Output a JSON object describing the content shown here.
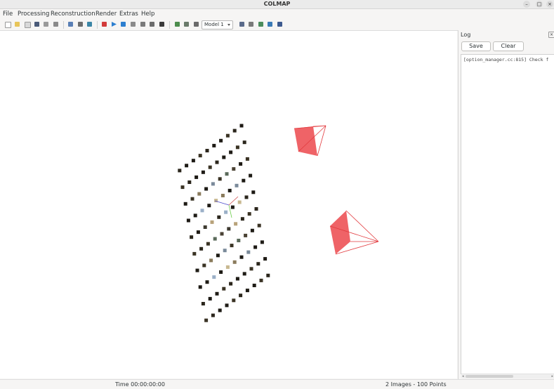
{
  "window": {
    "title": "COLMAP",
    "controls": {
      "minimize": "–",
      "maximize": "□",
      "close": "×"
    }
  },
  "menubar": {
    "items": [
      "File",
      "Processing",
      "Reconstruction",
      "Render",
      "Extras",
      "Help"
    ]
  },
  "toolbar": {
    "icons": [
      "new-project-icon",
      "open-project-icon",
      "edit-project-icon",
      "save-project-icon",
      "import-model-icon",
      "export-model-icon",
      "feature-extraction-icon",
      "feature-matching-icon",
      "database-management-icon",
      "automatic-reconstruction-icon",
      "start-reconstruction-icon",
      "step-reconstruction-icon",
      "pause-reconstruction-icon",
      "reset-reconstruction-icon",
      "bundle-adjustment-icon",
      "dense-reconstruction-icon",
      "render-options-icon",
      "grab-image-icon",
      "grab-movie-icon",
      "reconstruction-stats-icon",
      "match-matrix-icon",
      "log-icon",
      "undistort-icon",
      "export-icon"
    ],
    "model_select": {
      "value": "Model 1"
    }
  },
  "viewport": {
    "camera_color": "#ef6367",
    "camera_edge_color": "#e23a3e",
    "cameras": 2,
    "points": 100
  },
  "log": {
    "title": "Log",
    "save_label": "Save",
    "clear_label": "Clear",
    "lines": [
      "[option_manager.cc:815] Check f"
    ]
  },
  "status": {
    "time": "Time 00:00:00:00",
    "summary": "2 Images - 100 Points"
  }
}
